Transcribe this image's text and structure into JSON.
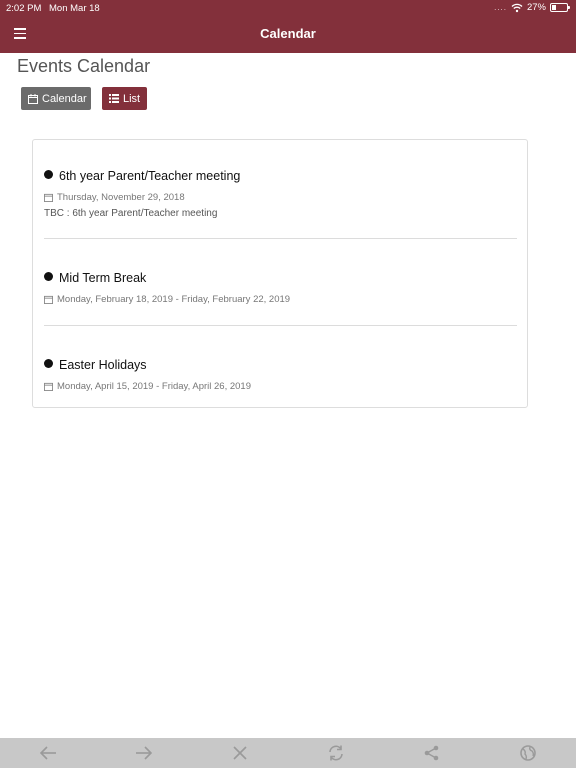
{
  "status_bar": {
    "time": "2:02 PM",
    "date": "Mon Mar 18",
    "signal_dots": "....",
    "battery_percent": "27%",
    "battery_level": 0.27
  },
  "nav": {
    "title": "Calendar",
    "background_color": "#83303b"
  },
  "page": {
    "title": "Events Calendar"
  },
  "view_toggle": {
    "calendar_label": "Calendar",
    "list_label": "List",
    "active": "List"
  },
  "events": [
    {
      "title": "6th year Parent/Teacher meeting",
      "date": "Thursday, November 29, 2018",
      "description": "TBC : 6th year Parent/Teacher meeting"
    },
    {
      "title": "Mid Term Break",
      "date": "Monday, February 18, 2019 - Friday, February 22, 2019"
    },
    {
      "title": "Easter Holidays",
      "date": "Monday, April 15, 2019 - Friday, April 26, 2019"
    }
  ],
  "toolbar": {
    "icons": [
      "back-arrow-icon",
      "forward-arrow-icon",
      "close-icon",
      "refresh-icon",
      "share-icon",
      "globe-icon"
    ]
  }
}
